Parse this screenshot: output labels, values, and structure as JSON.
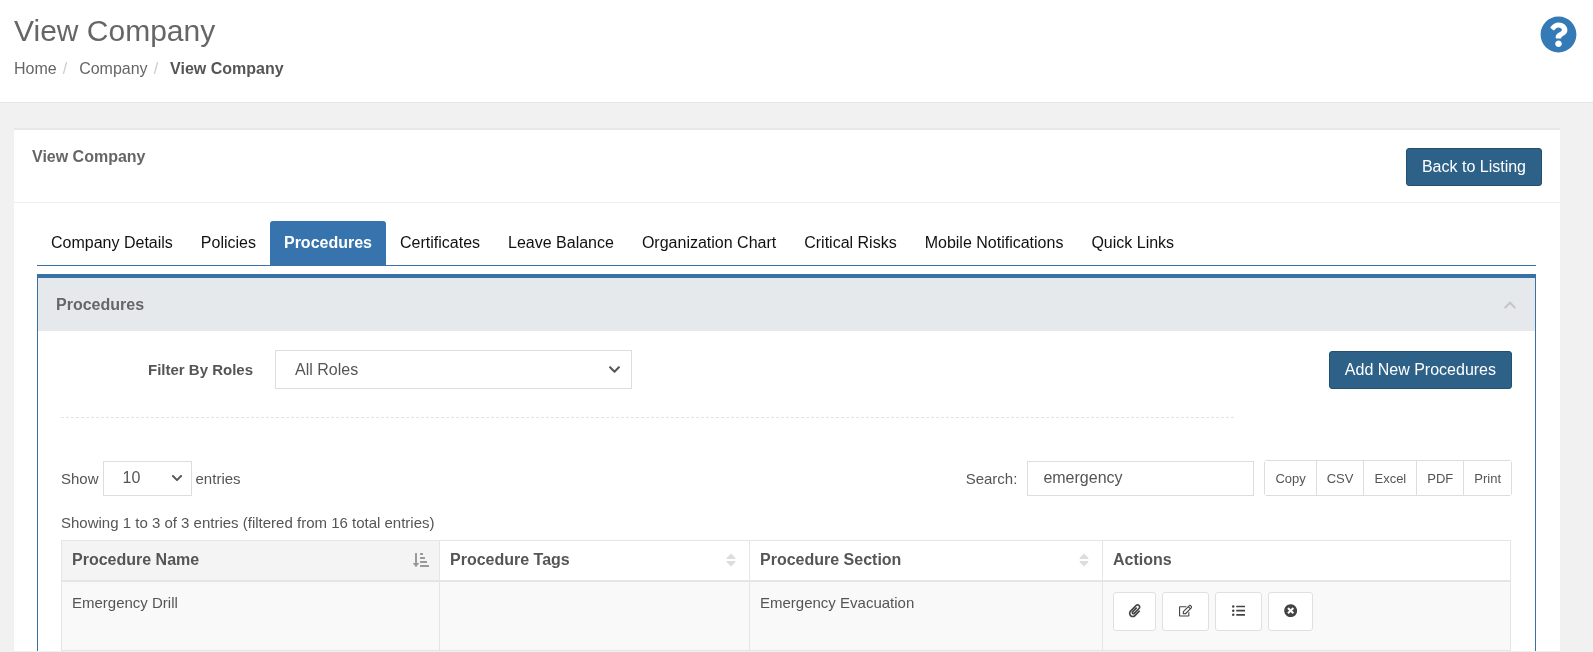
{
  "page": {
    "title": "View Company",
    "help": true
  },
  "breadcrumb": [
    {
      "label": "Home",
      "current": false,
      "separator": "/"
    },
    {
      "label": "Company",
      "current": false,
      "separator": "/"
    },
    {
      "label": "View Company",
      "current": true
    }
  ],
  "card": {
    "title": "View Company",
    "back_button": "Back to Listing"
  },
  "tabs": [
    {
      "label": "Company Details",
      "selected": false
    },
    {
      "label": "Policies",
      "selected": false
    },
    {
      "label": "Procedures",
      "selected": true
    },
    {
      "label": "Certificates",
      "selected": false
    },
    {
      "label": "Leave Balance",
      "selected": false
    },
    {
      "label": "Organization Chart",
      "selected": false
    },
    {
      "label": "Critical Risks",
      "selected": false
    },
    {
      "label": "Mobile Notifications",
      "selected": false
    },
    {
      "label": "Quick Links",
      "selected": false
    }
  ],
  "panel": {
    "title": "Procedures",
    "expanded": true,
    "filter": {
      "label": "Filter By Roles",
      "value": "All Roles"
    },
    "add_button": "Add New Procedures",
    "length": {
      "prefix": "Show",
      "value": "10",
      "suffix": "entries"
    },
    "search": {
      "label": "Search:",
      "value": "emergency"
    },
    "export_buttons": [
      "Copy",
      "CSV",
      "Excel",
      "PDF",
      "Print"
    ],
    "info": "Showing 1 to 3 of 3 entries (filtered from 16 total entries)",
    "table": {
      "columns": [
        {
          "label": "Procedure Name",
          "sortable": true,
          "sorted": true
        },
        {
          "label": "Procedure Tags",
          "sortable": true,
          "sorted": false
        },
        {
          "label": "Procedure Section",
          "sortable": true,
          "sorted": false
        },
        {
          "label": "Actions",
          "sortable": false,
          "sorted": false
        }
      ],
      "rows": [
        {
          "cells": [
            "Emergency Drill",
            "",
            "Emergency Evacuation"
          ],
          "actions": [
            {
              "kind": "attach"
            },
            {
              "kind": "edit"
            },
            {
              "kind": "list"
            },
            {
              "kind": "delete"
            }
          ]
        }
      ]
    }
  }
}
